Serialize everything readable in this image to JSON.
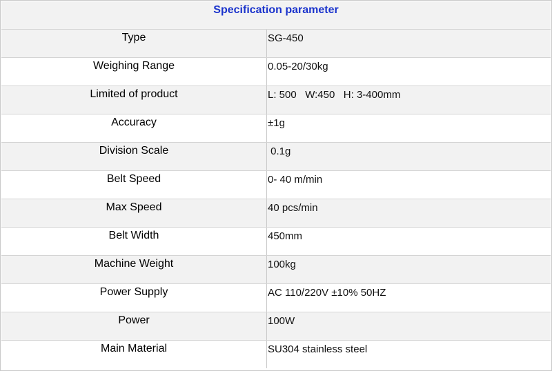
{
  "title": "Specification parameter",
  "rows": [
    {
      "label": "Type",
      "value": "SG-450"
    },
    {
      "label": "Weighing Range",
      "value": "0.05-20/30kg"
    },
    {
      "label": "Limited of product",
      "value": "L: 500   W:450   H: 3-400mm"
    },
    {
      "label": "Accuracy",
      "value": "±1g"
    },
    {
      "label": "Division Scale",
      "value": " 0.1g"
    },
    {
      "label": "Belt Speed",
      "value": "0- 40 m/min"
    },
    {
      "label": "Max Speed",
      "value": "40 pcs/min"
    },
    {
      "label": "Belt Width",
      "value": "450mm"
    },
    {
      "label": "Machine Weight",
      "value": "100kg"
    },
    {
      "label": "Power Supply",
      "value": "AC 110/220V ±10% 50HZ"
    },
    {
      "label": "Power",
      "value": "100W"
    },
    {
      "label": "Main Material",
      "value": "SU304 stainless steel"
    }
  ]
}
